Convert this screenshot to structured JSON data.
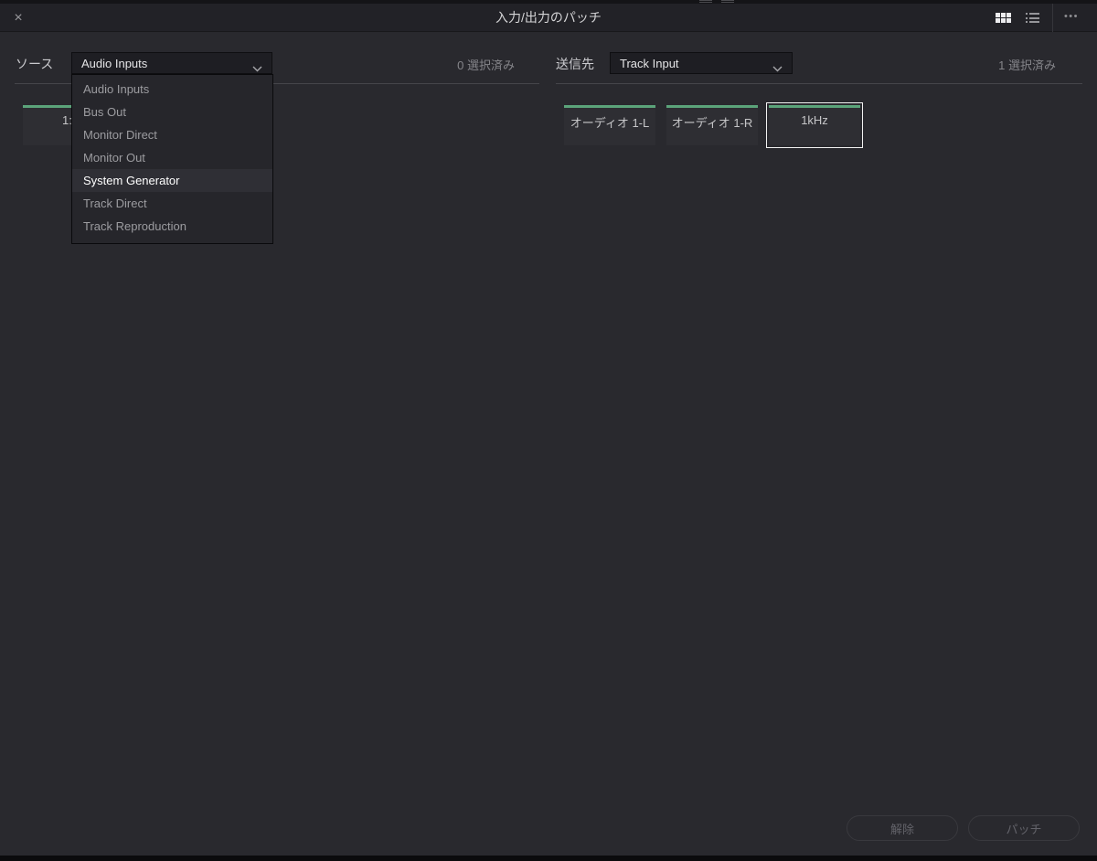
{
  "titlebar": {
    "title": "入力/出力のパッチ"
  },
  "icons": {
    "close": "×",
    "more": "•••",
    "grid_view": "grid-icon",
    "list_view": "list-icon",
    "dropdown_chevron": "chevron-down"
  },
  "source_panel": {
    "label": "ソース",
    "dropdown_value": "Audio Inputs",
    "selected_count": "0 選択済み",
    "card": {
      "label": "1:"
    },
    "menu_items": [
      {
        "label": "Audio Inputs",
        "highlighted": false
      },
      {
        "label": "Bus Out",
        "highlighted": false
      },
      {
        "label": "Monitor Direct",
        "highlighted": false
      },
      {
        "label": "Monitor Out",
        "highlighted": false
      },
      {
        "label": "System Generator",
        "highlighted": true
      },
      {
        "label": "Track Direct",
        "highlighted": false
      },
      {
        "label": "Track Reproduction",
        "highlighted": false
      }
    ]
  },
  "destination_panel": {
    "label": "送信先",
    "dropdown_value": "Track Input",
    "selected_count": "1 選択済み",
    "cards": [
      {
        "label": "オーディオ 1-L",
        "selected": false
      },
      {
        "label": "オーディオ 1-R",
        "selected": false
      },
      {
        "label": "1kHz",
        "selected": true
      }
    ]
  },
  "footer": {
    "unpatch_label": "解除",
    "patch_label": "パッチ"
  },
  "colors": {
    "accent_green": "#5ba47a",
    "selection_border": "#f2f2f2",
    "dialog_bg": "#29292e",
    "titlebar_bg": "#222227"
  }
}
